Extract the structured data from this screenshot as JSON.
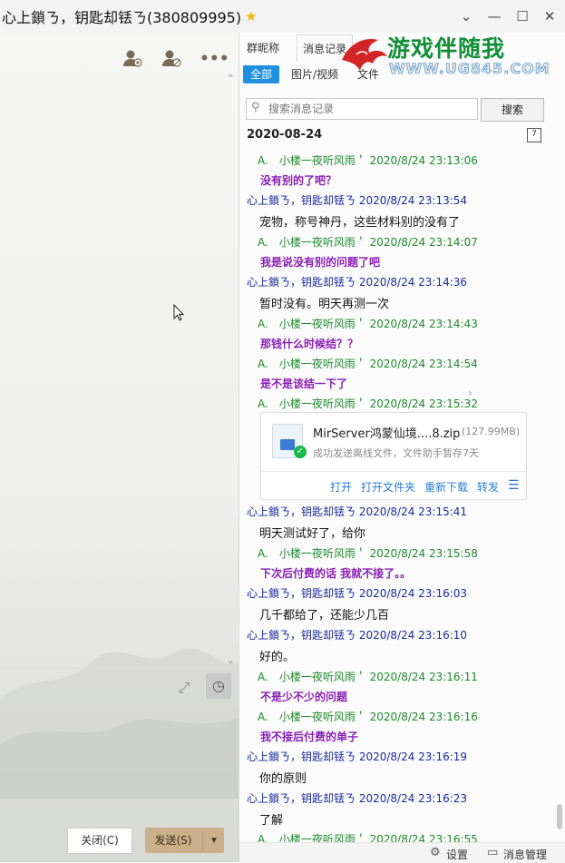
{
  "window": {
    "title": "心上鎖ㄋ，钥匙却铥ㄋ(380809995)",
    "star": "★"
  },
  "left_toolbar": {
    "icons": [
      "add-member-icon",
      "block-member-icon",
      "more-icon"
    ],
    "more_label": "•••"
  },
  "compose": {
    "close_label": "关闭(C)",
    "send_label": "发送(S)",
    "send_arrow": "▾"
  },
  "right_panel": {
    "tabs": [
      "群昵称",
      "消息记录"
    ],
    "logo_text": "游戏伴随我",
    "logo_url": "WWW.UG845.COM",
    "filters": [
      "全部",
      "图片/视频",
      "文件"
    ],
    "search": {
      "placeholder": "搜索消息记录",
      "button_label": "搜索"
    },
    "date": "2020-08-24",
    "messages": [
      {
        "sender": "A.　小楼一夜听风雨＇ 2020/8/24 23:13:06",
        "text": "没有别的了吧？",
        "style": "g"
      },
      {
        "sender": "心上鎖ㄋ，钥匙却铥ㄋ 2020/8/24 23:13:54",
        "text": "宠物，称号神丹，这些材料别的没有了",
        "style": "b"
      },
      {
        "sender": "A.　小楼一夜听风雨＇ 2020/8/24 23:14:07",
        "text": "我是说没有别的问题了吧",
        "style": "g"
      },
      {
        "sender": "心上鎖ㄋ，钥匙却铥ㄋ 2020/8/24 23:14:36",
        "text": "暂时没有。明天再测一次",
        "style": "b"
      },
      {
        "sender": "A.　小楼一夜听风雨＇ 2020/8/24 23:14:43",
        "text": "那钱什么时候结？？",
        "style": "g"
      },
      {
        "sender": "A.　小楼一夜听风雨＇ 2020/8/24 23:14:54",
        "text": "是不是该结一下了",
        "style": "g"
      },
      {
        "sender": "A.　小楼一夜听风雨＇ 2020/8/24 23:15:32",
        "text": "",
        "style": "g"
      },
      {
        "sender": "心上鎖ㄋ，钥匙却铥ㄋ 2020/8/24 23:15:41",
        "text": "明天测试好了，给你",
        "style": "b"
      },
      {
        "sender": "A.　小楼一夜听风雨＇ 2020/8/24 23:15:58",
        "text": "下次后付费的话 我就不接了。。",
        "style": "g"
      },
      {
        "sender": "心上鎖ㄋ，钥匙却铥ㄋ 2020/8/24 23:16:03",
        "text": "几千都给了，还能少几百",
        "style": "b"
      },
      {
        "sender": "心上鎖ㄋ，钥匙却铥ㄋ 2020/8/24 23:16:10",
        "text": "好的。",
        "style": "b"
      },
      {
        "sender": "A.　小楼一夜听风雨＇ 2020/8/24 23:16:11",
        "text": "不是少不少的问题",
        "style": "g"
      },
      {
        "sender": "A.　小楼一夜听风雨＇ 2020/8/24 23:16:16",
        "text": "我不接后付费的单子",
        "style": "g"
      },
      {
        "sender": "心上鎖ㄋ，钥匙却铥ㄋ 2020/8/24 23:16:19",
        "text": "你的原则",
        "style": "b"
      },
      {
        "sender": "心上鎖ㄋ，钥匙却铥ㄋ 2020/8/24 23:16:23",
        "text": "了解",
        "style": "b"
      },
      {
        "sender": "A.　小楼一夜听风雨＇ 2020/8/24 23:16:55",
        "text": "",
        "style": "g"
      }
    ],
    "file": {
      "name": "MirServer鸿蒙仙境....8.zip",
      "size": "(127.99MB)",
      "status": "成功发送离线文件，文件助手暂存7天",
      "actions": [
        "打开",
        "打开文件夹",
        "重新下载",
        "转发"
      ]
    },
    "bottom": {
      "settings_label": "设置",
      "manage_label": "消息管理"
    }
  }
}
